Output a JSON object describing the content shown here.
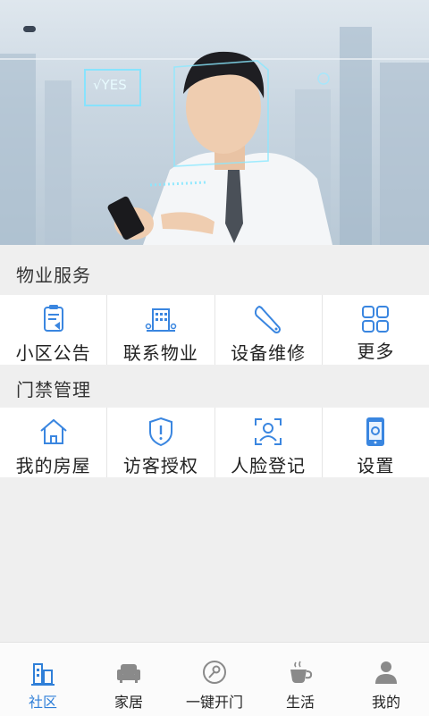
{
  "banner": {
    "hud_text": "√YES"
  },
  "property_services": {
    "title": "物业服务",
    "items": [
      {
        "label": "小区公告",
        "icon": "notice-icon"
      },
      {
        "label": "联系物业",
        "icon": "building-icon"
      },
      {
        "label": "设备维修",
        "icon": "wrench-icon"
      },
      {
        "label": "更多",
        "icon": "grid-more-icon"
      }
    ]
  },
  "access_control": {
    "title": "门禁管理",
    "items": [
      {
        "label": "我的房屋",
        "icon": "home-icon"
      },
      {
        "label": "访客授权",
        "icon": "shield-alert-icon"
      },
      {
        "label": "人脸登记",
        "icon": "face-id-icon"
      },
      {
        "label": "设置",
        "icon": "phone-settings-icon"
      }
    ]
  },
  "nav": {
    "items": [
      {
        "label": "社区",
        "icon": "community-icon",
        "active": true
      },
      {
        "label": "家居",
        "icon": "sofa-icon",
        "active": false
      },
      {
        "label": "一键开门",
        "icon": "key-icon",
        "active": false
      },
      {
        "label": "生活",
        "icon": "coffee-icon",
        "active": false
      },
      {
        "label": "我的",
        "icon": "user-icon",
        "active": false
      }
    ]
  },
  "colors": {
    "accent": "#2f7fd8",
    "icon_blue": "#3a86e0",
    "background": "#efefef"
  }
}
